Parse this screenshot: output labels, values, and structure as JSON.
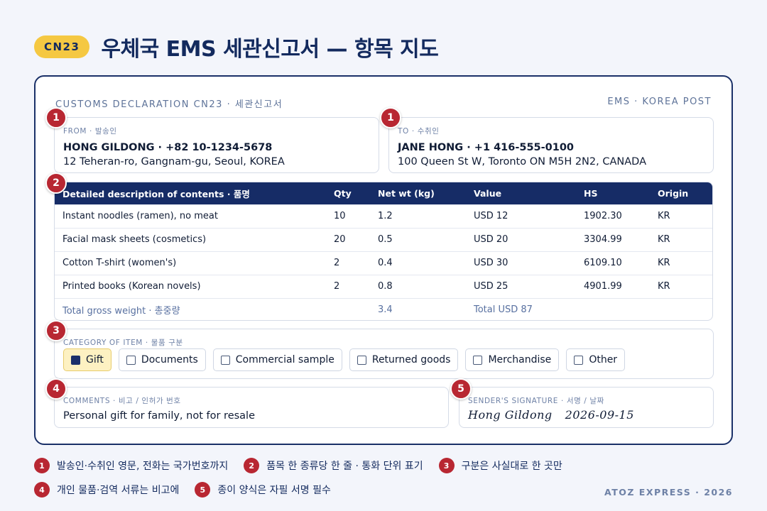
{
  "header": {
    "badge": "CN23",
    "title": "우체국 EMS 세관신고서 — 항목 지도"
  },
  "form": {
    "head_left": "CUSTOMS DECLARATION CN23 · 세관신고서",
    "head_right": "EMS · KOREA POST",
    "from": {
      "label": "FROM · 발송인",
      "line1": "HONG GILDONG · +82 10-1234-5678",
      "line2": "12 Teheran-ro, Gangnam-gu, Seoul, KOREA"
    },
    "to": {
      "label": "TO · 수취인",
      "line1": "JANE HONG · +1 416-555-0100",
      "line2": "100 Queen St W, Toronto ON M5H 2N2, CANADA"
    },
    "table": {
      "headers": [
        "Detailed description of contents · 품명",
        "Qty",
        "Net wt (kg)",
        "Value",
        "HS",
        "Origin"
      ],
      "rows": [
        [
          "Instant noodles (ramen), no meat",
          "10",
          "1.2",
          "USD 12",
          "1902.30",
          "KR"
        ],
        [
          "Facial mask sheets (cosmetics)",
          "20",
          "0.5",
          "USD 20",
          "3304.99",
          "KR"
        ],
        [
          "Cotton T-shirt (women's)",
          "2",
          "0.4",
          "USD 30",
          "6109.10",
          "KR"
        ],
        [
          "Printed books (Korean novels)",
          "2",
          "0.8",
          "USD 25",
          "4901.99",
          "KR"
        ]
      ],
      "total": {
        "label": "Total gross weight · 총중량",
        "weight": "3.4",
        "value": "Total USD 87"
      }
    },
    "category": {
      "label": "CATEGORY OF ITEM · 물품 구분",
      "options": [
        "Gift",
        "Documents",
        "Commercial sample",
        "Returned goods",
        "Merchandise",
        "Other"
      ],
      "selected": "Gift"
    },
    "comments": {
      "label": "COMMENTS · 비고 / 인허가 번호",
      "value": "Personal gift for family, not for resale"
    },
    "signature": {
      "label": "SENDER'S SIGNATURE · 서명 / 날짜",
      "name": "Hong Gildong",
      "date": "2026-09-15"
    }
  },
  "markers": [
    "1",
    "1",
    "2",
    "3",
    "4",
    "5"
  ],
  "legend": [
    {
      "num": "1",
      "text": "발송인·수취인 영문, 전화는 국가번호까지"
    },
    {
      "num": "2",
      "text": "품목 한 종류당 한 줄 · 통화 단위 표기"
    },
    {
      "num": "3",
      "text": "구분은 사실대로 한 곳만"
    },
    {
      "num": "4",
      "text": "개인 물품·검역 서류는 비고에"
    },
    {
      "num": "5",
      "text": "종이 양식은 자필 서명 필수"
    }
  ],
  "footer": {
    "brand": "ATOZ EXPRESS · 2026"
  },
  "colors": {
    "navy": "#162c66",
    "accent_yellow": "#f5c842",
    "marker_red": "#b82732"
  }
}
